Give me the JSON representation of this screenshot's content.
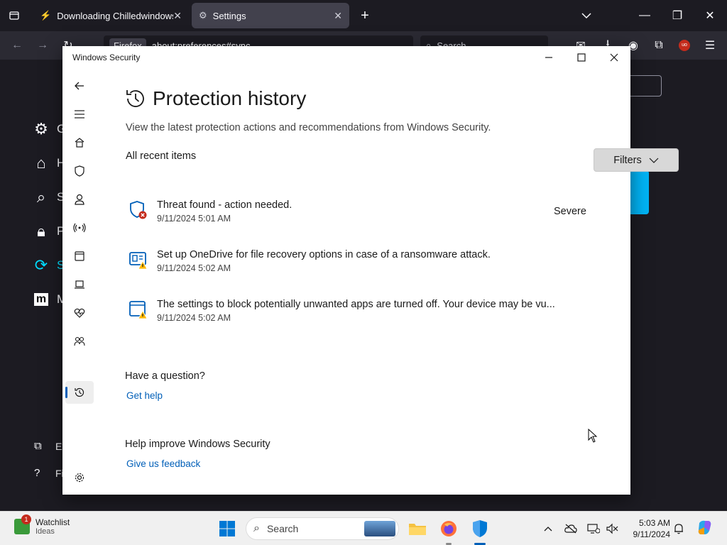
{
  "browser": {
    "tabs": [
      {
        "title": "Downloading Chilledwindows.e",
        "active": false
      },
      {
        "title": "Settings",
        "active": true
      }
    ],
    "url_identity": "Firefox",
    "url_text": "about:preferences#sync",
    "search_placeholder": "Search",
    "sidebar": [
      {
        "label": "G",
        "icon": "gear-icon"
      },
      {
        "label": "H",
        "icon": "home-icon"
      },
      {
        "label": "S",
        "icon": "search-icon"
      },
      {
        "label": "P",
        "icon": "lock-icon"
      },
      {
        "label": "S",
        "icon": "sync-icon"
      },
      {
        "label": "M",
        "icon": "mozilla-icon"
      }
    ],
    "sidebar_bottom": [
      {
        "label": "Ex",
        "icon": "extensions-icon"
      },
      {
        "label": "Fi",
        "icon": "help-icon"
      }
    ]
  },
  "window": {
    "title": "Windows Security"
  },
  "page": {
    "title": "Protection history",
    "description": "View the latest protection actions and recommendations from Windows Security.",
    "section_label": "All recent items",
    "filters_label": "Filters",
    "items": [
      {
        "title": "Threat found - action needed.",
        "date": "9/11/2024 5:01 AM",
        "severity": "Severe",
        "icon": "shield-error-icon"
      },
      {
        "title": "Set up OneDrive for file recovery options in case of a ransomware attack.",
        "date": "9/11/2024 5:02 AM",
        "severity": "",
        "icon": "ransomware-warning-icon"
      },
      {
        "title": "The settings to block potentially unwanted apps are turned off. Your device may be vu...",
        "date": "9/11/2024 5:02 AM",
        "severity": "",
        "icon": "app-browser-warning-icon"
      }
    ],
    "question_heading": "Have a question?",
    "question_link": "Get help",
    "feedback_heading": "Help improve Windows Security",
    "feedback_link": "Give us feedback"
  },
  "taskbar": {
    "widget_title": "Watchlist",
    "widget_subtitle": "Ideas",
    "widget_badge": "1",
    "search_label": "Search",
    "time": "5:03 AM",
    "date": "9/11/2024"
  },
  "colors": {
    "accent": "#005fb8",
    "error": "#c42b1c",
    "warning": "#ffb900"
  }
}
